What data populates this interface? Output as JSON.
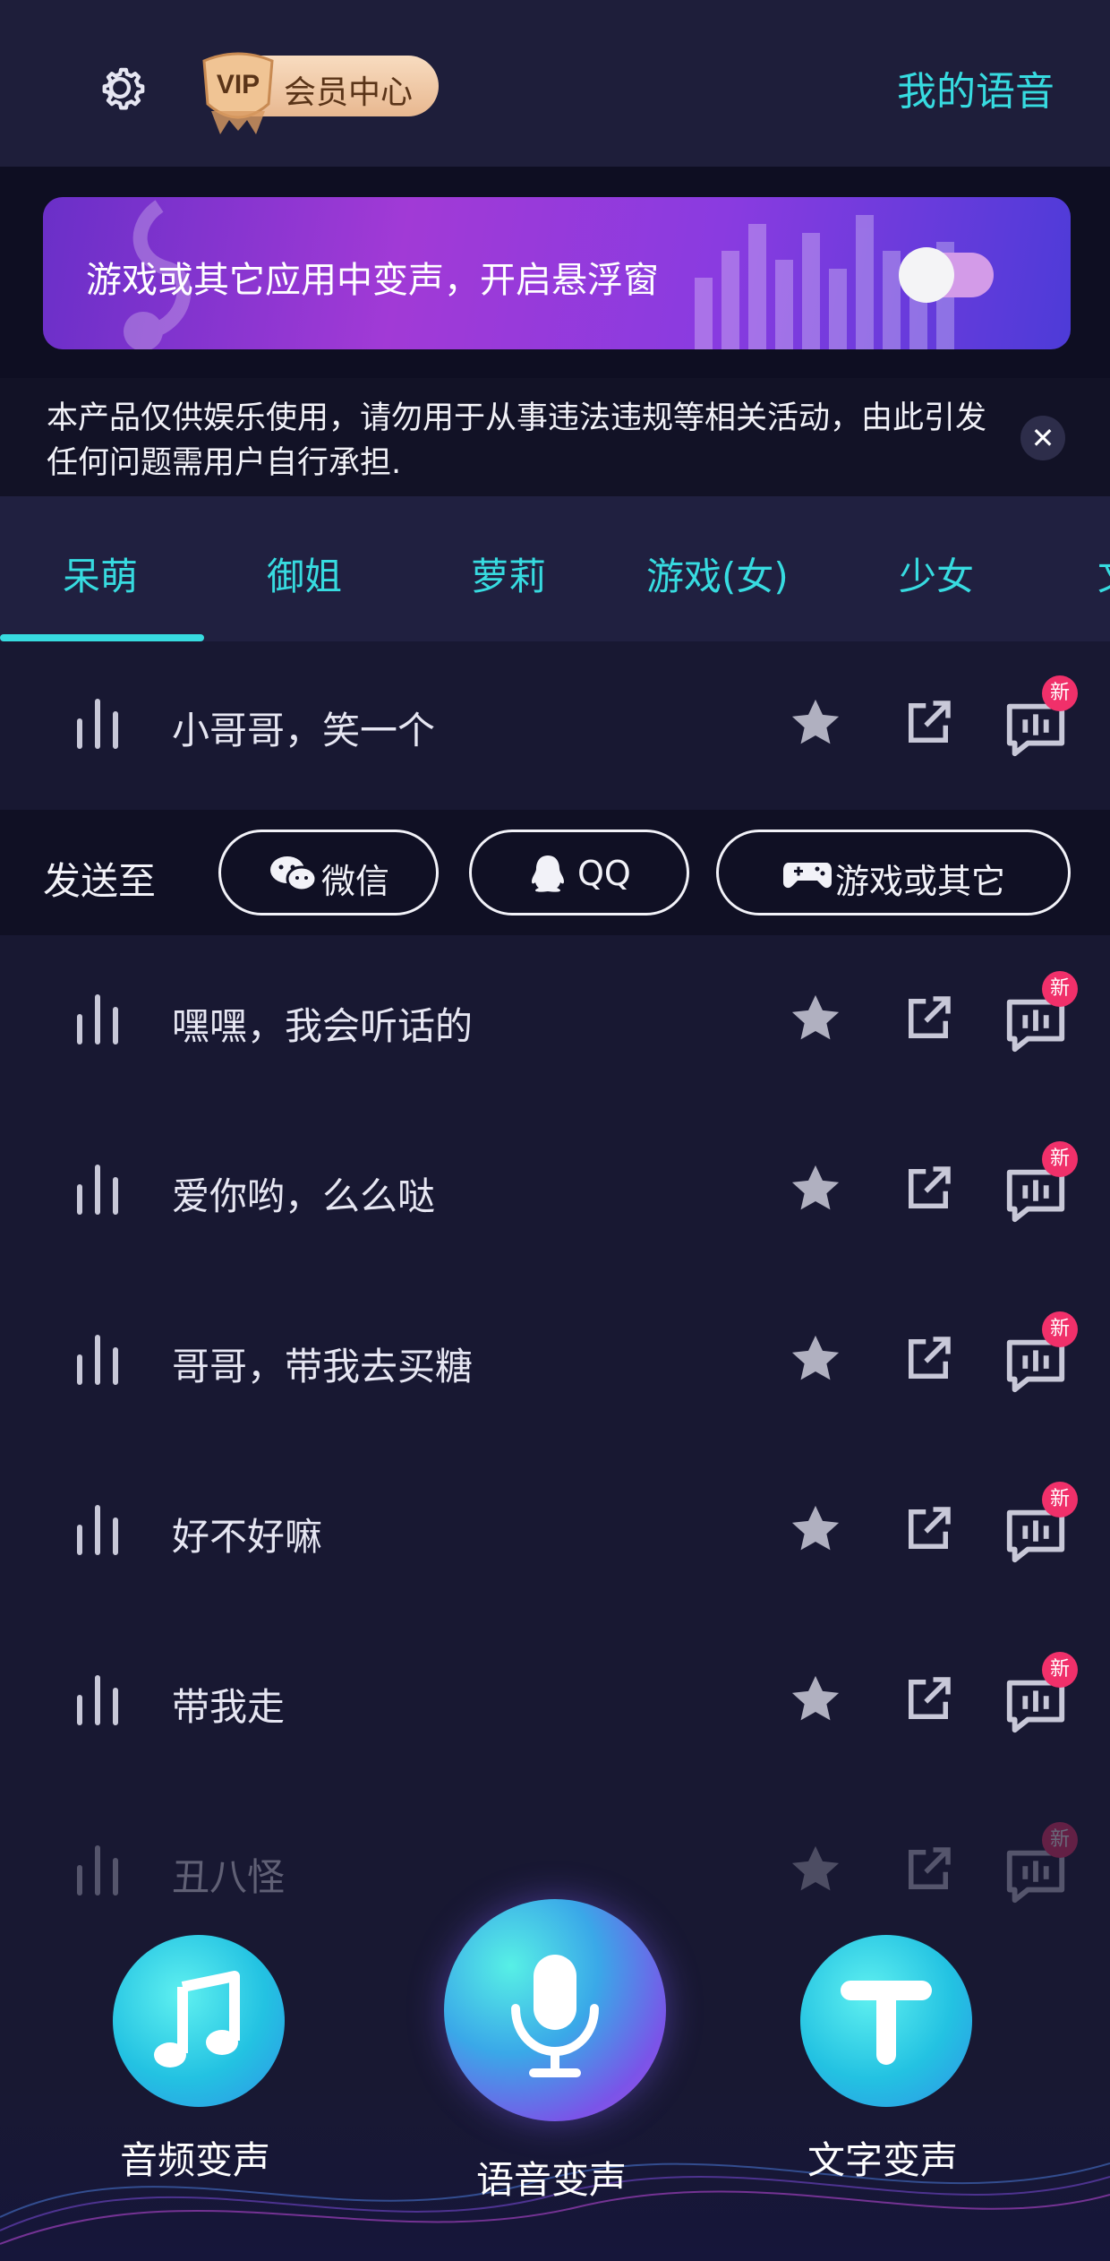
{
  "header": {
    "vip_label": "会员中心",
    "vip_badge_text": "VIP",
    "my_voice": "我的语音"
  },
  "banner": {
    "text": "游戏或其它应用中变声，开启悬浮窗",
    "toggle_on": false
  },
  "notice": {
    "text": "本产品仅供娱乐使用，请勿用于从事违法违规等相关活动，由此引发任何问题需用户自行承担."
  },
  "tabs": {
    "items": [
      "呆萌",
      "御姐",
      "萝莉",
      "游戏(女)",
      "少女",
      "文"
    ],
    "active_index": 0
  },
  "send_to": {
    "label": "发送至",
    "wechat": "微信",
    "qq": "QQ",
    "games": "游戏或其它"
  },
  "voice_list": [
    {
      "label": "小哥哥，笑一个",
      "badge": "新"
    },
    {
      "label": "嘿嘿，我会听话的",
      "badge": "新"
    },
    {
      "label": "爱你哟，么么哒",
      "badge": "新"
    },
    {
      "label": "哥哥，带我去买糖",
      "badge": "新"
    },
    {
      "label": "好不好嘛",
      "badge": "新"
    },
    {
      "label": "带我走",
      "badge": "新"
    },
    {
      "label": "丑八怪",
      "badge": "新"
    }
  ],
  "bottom_nav": {
    "audio": "音频变声",
    "voice": "语音变声",
    "text": "文字变声"
  },
  "colors": {
    "accent": "#37dbe0",
    "badge": "#f0306a",
    "background": "#181832"
  }
}
